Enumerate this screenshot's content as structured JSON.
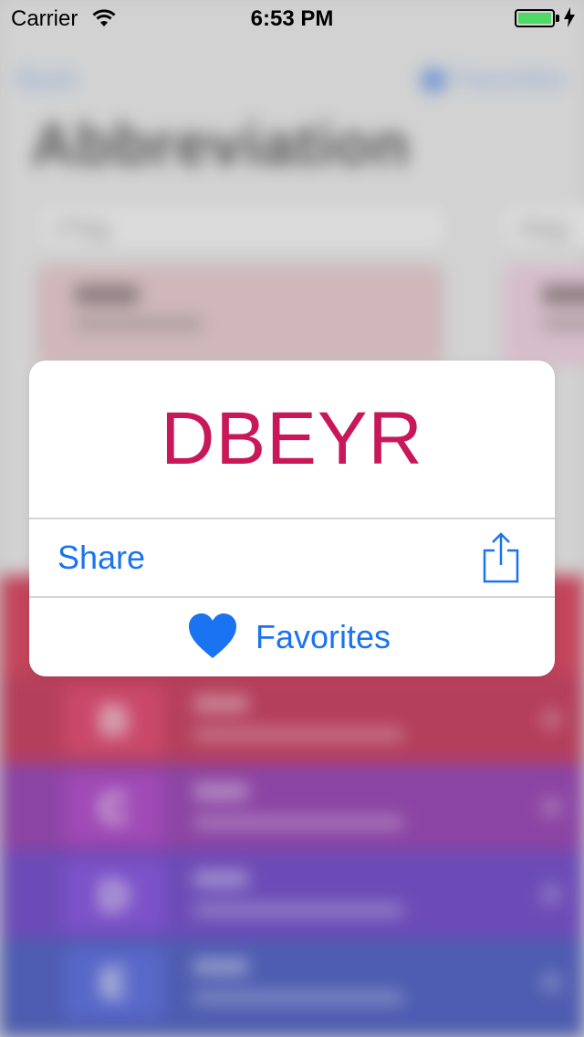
{
  "status_bar": {
    "carrier": "Carrier",
    "time": "6:53 PM",
    "battery_color": "#4cd964"
  },
  "background": {
    "nav_left": "Back",
    "nav_right": "Favorites",
    "title": "Abbreviation",
    "tag_left": "#Tag",
    "tag_right": "#tag",
    "rows": [
      {
        "letter": "B",
        "color": "#c21a4a"
      },
      {
        "letter": "C",
        "color": "#8a1fa6"
      },
      {
        "letter": "D",
        "color": "#5b2bbf"
      },
      {
        "letter": "E",
        "color": "#2d44b8"
      }
    ]
  },
  "popup": {
    "abbreviation": "DBEYR",
    "abbreviation_color": "#c8185a",
    "share_label": "Share",
    "share_icon": "share-icon",
    "favorites_label": "Favorites",
    "favorites_icon": "heart-icon",
    "accent_color": "#1a73f0"
  }
}
